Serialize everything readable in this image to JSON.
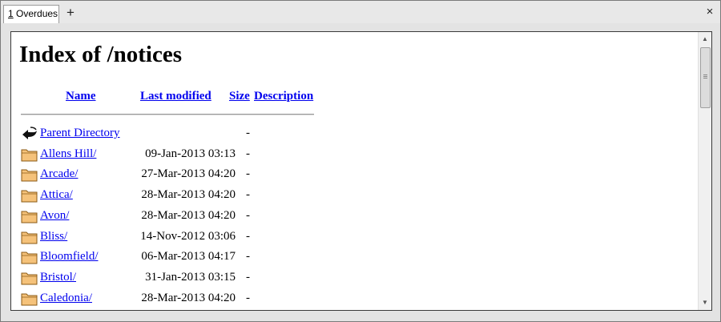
{
  "tabs": [
    {
      "number": "1",
      "title": "Overdues"
    }
  ],
  "new_tab_label": "+",
  "close_label": "×",
  "page": {
    "title": "Index of /notices",
    "columns": {
      "name": "Name",
      "last_modified": "Last modified",
      "size": "Size",
      "description": "Description"
    },
    "entries": [
      {
        "name": "Parent Directory",
        "modified": "",
        "size": "-",
        "icon": "back-arrow-icon"
      },
      {
        "name": "Allens Hill/",
        "modified": "09-Jan-2013 03:13",
        "size": "-",
        "icon": "folder-icon"
      },
      {
        "name": "Arcade/",
        "modified": "27-Mar-2013 04:20",
        "size": "-",
        "icon": "folder-icon"
      },
      {
        "name": "Attica/",
        "modified": "28-Mar-2013 04:20",
        "size": "-",
        "icon": "folder-icon"
      },
      {
        "name": "Avon/",
        "modified": "28-Mar-2013 04:20",
        "size": "-",
        "icon": "folder-icon"
      },
      {
        "name": "Bliss/",
        "modified": "14-Nov-2012 03:06",
        "size": "-",
        "icon": "folder-icon"
      },
      {
        "name": "Bloomfield/",
        "modified": "06-Mar-2013 04:17",
        "size": "-",
        "icon": "folder-icon"
      },
      {
        "name": "Bristol/",
        "modified": "31-Jan-2013 03:15",
        "size": "-",
        "icon": "folder-icon"
      },
      {
        "name": "Caledonia/",
        "modified": "28-Mar-2013 04:20",
        "size": "-",
        "icon": "folder-icon"
      }
    ]
  },
  "colors": {
    "link": "#0000ee",
    "folder_fill": "#f5c27a",
    "folder_stroke": "#8a5a14"
  }
}
